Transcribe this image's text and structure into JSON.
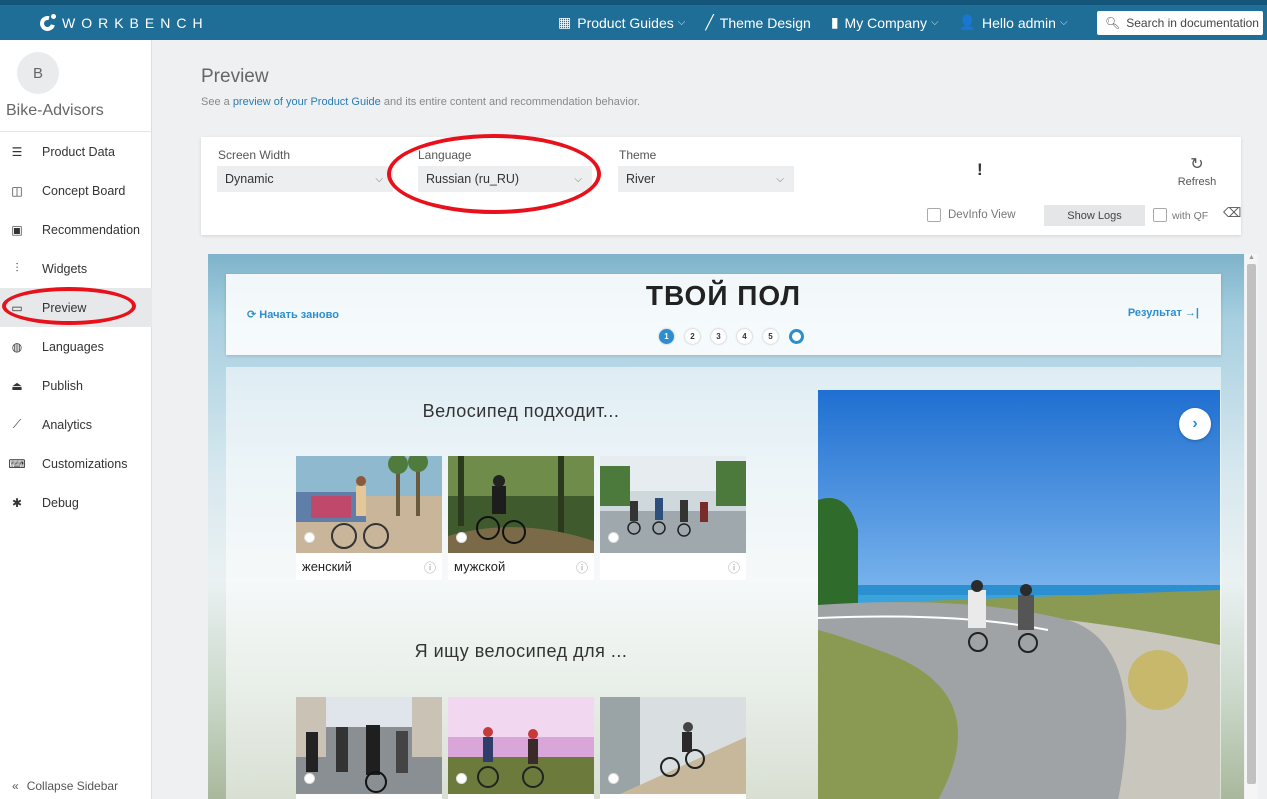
{
  "topbar": {
    "brand": "WORKBENCH",
    "nav": [
      {
        "label": "Product Guides",
        "icon": "grid-icon",
        "has_menu": true
      },
      {
        "label": "Theme Design",
        "icon": "brush-icon",
        "has_menu": false
      },
      {
        "label": "My Company",
        "icon": "briefcase-icon",
        "has_menu": true
      },
      {
        "label": "Hello admin",
        "icon": "user-icon",
        "has_menu": true
      }
    ],
    "search_placeholder": "Search in documentation"
  },
  "sidebar": {
    "avatar_letter": "B",
    "company": "Bike-Advisors",
    "items": [
      {
        "label": "Product Data",
        "icon": "database-icon"
      },
      {
        "label": "Concept Board",
        "icon": "board-icon"
      },
      {
        "label": "Recommendation",
        "icon": "gift-icon"
      },
      {
        "label": "Widgets",
        "icon": "sliders-icon"
      },
      {
        "label": "Preview",
        "icon": "monitor-icon",
        "active": true
      },
      {
        "label": "Languages",
        "icon": "globe-icon"
      },
      {
        "label": "Publish",
        "icon": "upload-icon"
      },
      {
        "label": "Analytics",
        "icon": "chart-icon"
      },
      {
        "label": "Customizations",
        "icon": "keyboard-icon"
      },
      {
        "label": "Debug",
        "icon": "bug-icon"
      }
    ],
    "collapse_label": "Collapse Sidebar"
  },
  "header": {
    "title": "Preview",
    "subtitle_pre": "See a ",
    "subtitle_link": "preview of your Product Guide",
    "subtitle_post": " and its entire content and recommendation behavior."
  },
  "controls": {
    "screen_width_label": "Screen Width",
    "screen_width_value": "Dynamic",
    "language_label": "Language",
    "language_value": "Russian (ru_RU)",
    "theme_label": "Theme",
    "theme_value": "River",
    "warning": "!",
    "refresh_label": "Refresh",
    "devinfo_label": "DevInfo View",
    "show_logs_label": "Show Logs",
    "with_qf_label": "with QF"
  },
  "guide": {
    "restart": "Начать заново",
    "title": "ТВОЙ ПОЛ",
    "steps": [
      "1",
      "2",
      "3",
      "4",
      "5"
    ],
    "active_step": 0,
    "result": "Результат",
    "question1": "Велосипед подходит...",
    "options1": [
      {
        "label": "женский"
      },
      {
        "label": "мужской"
      },
      {
        "label": ""
      }
    ],
    "question2": "Я ищу велосипед для ..."
  },
  "colors": {
    "topbar": "#1e6e97",
    "accent": "#2d8ecf",
    "annotation": "#e8101a"
  }
}
